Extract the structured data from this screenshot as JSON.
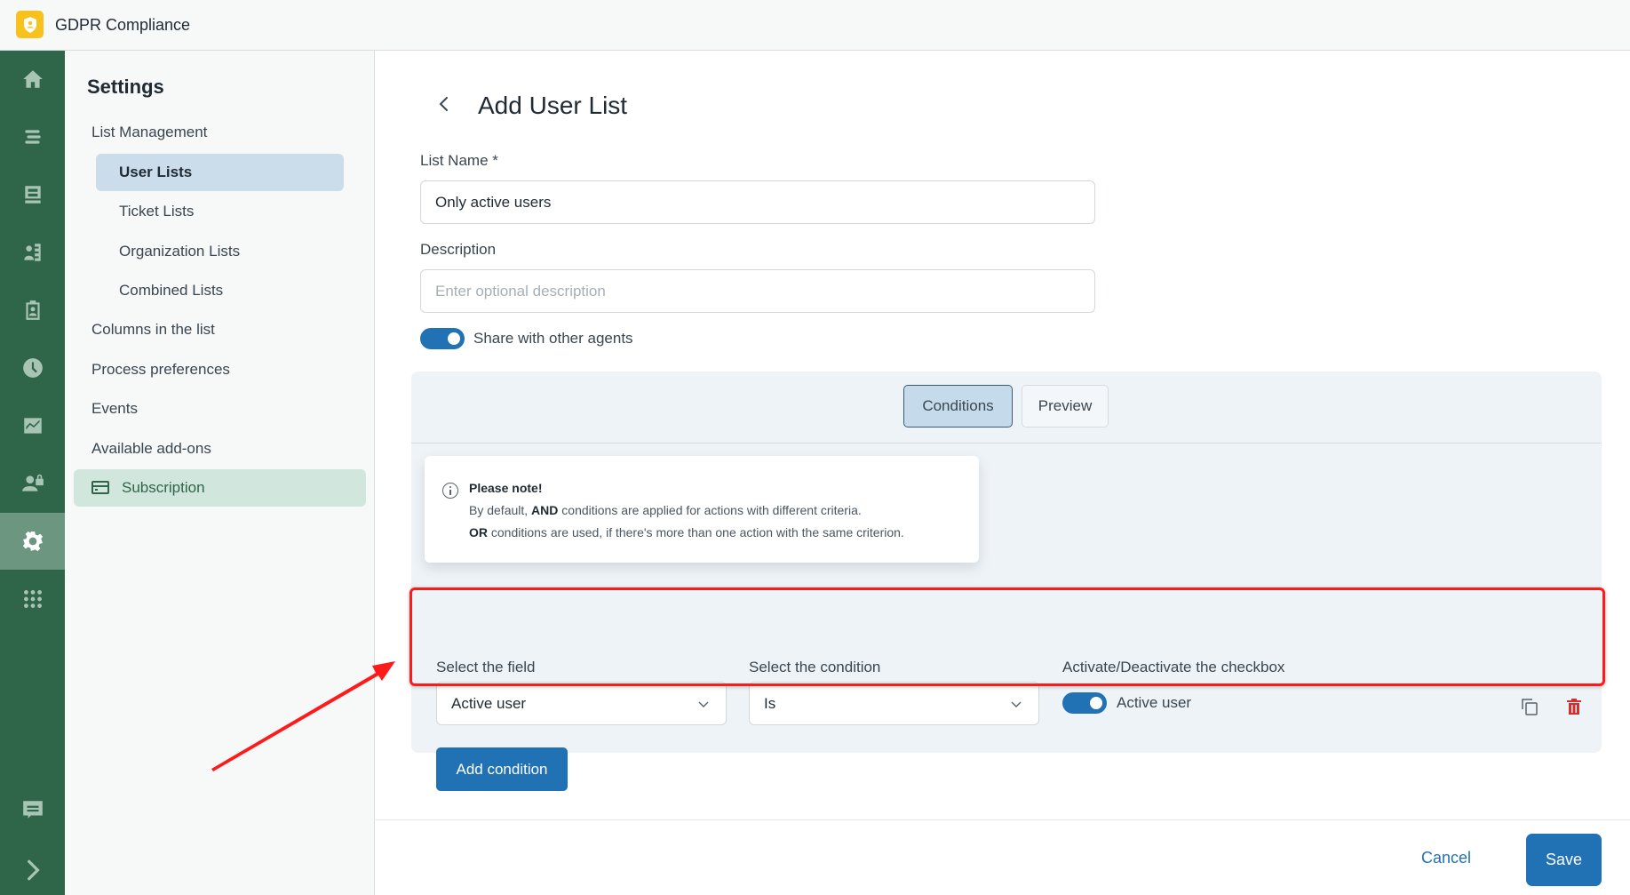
{
  "app": {
    "title": "GDPR Compliance",
    "logo_icon": "shield-user-icon"
  },
  "leftnav": {
    "items": [
      {
        "icon": "home-icon"
      },
      {
        "icon": "list-icon"
      },
      {
        "icon": "inbox-icon"
      },
      {
        "icon": "contacts-book-icon"
      },
      {
        "icon": "badge-icon"
      },
      {
        "icon": "clock-icon"
      },
      {
        "icon": "chart-icon"
      },
      {
        "icon": "user-lock-icon"
      },
      {
        "icon": "gear-icon",
        "active": true
      },
      {
        "icon": "apps-grid-icon"
      },
      {
        "icon": "chat-icon"
      },
      {
        "icon": "chevron-right-icon"
      }
    ]
  },
  "settings": {
    "title": "Settings",
    "menu": [
      {
        "label": "List Management",
        "level": "top"
      },
      {
        "label": "User Lists",
        "level": "sub",
        "selected": true
      },
      {
        "label": "Ticket Lists",
        "level": "sub"
      },
      {
        "label": "Organization Lists",
        "level": "sub"
      },
      {
        "label": "Combined Lists",
        "level": "sub"
      },
      {
        "label": "Columns in the list",
        "level": "top"
      },
      {
        "label": "Process preferences",
        "level": "top"
      },
      {
        "label": "Events",
        "level": "top"
      },
      {
        "label": "Available add-ons",
        "level": "top"
      },
      {
        "label": "Subscription",
        "level": "top",
        "icon": "credit-card-icon"
      }
    ]
  },
  "form": {
    "title": "Add User List",
    "list_name_label": "List Name *",
    "list_name_value": "Only active users",
    "description_label": "Description",
    "description_placeholder": "Enter optional description",
    "share_label": "Share with other agents",
    "share_enabled": true
  },
  "tabs": {
    "conditions": "Conditions",
    "preview": "Preview",
    "active": "Conditions"
  },
  "note": {
    "title": "Please note!",
    "line1_prefix": "By default, ",
    "line1_bold": "AND",
    "line1_suffix": " conditions are applied for actions with different criteria.",
    "line2_bold": "OR",
    "line2_suffix": " conditions are used, if there's more than one action with the same criterion."
  },
  "condition": {
    "field_label": "Select the field",
    "field_value": "Active user",
    "condition_label": "Select the condition",
    "condition_value": "Is",
    "checkbox_label": "Activate/Deactivate the checkbox",
    "checkbox_value_label": "Active user",
    "checkbox_enabled": true
  },
  "buttons": {
    "add_condition": "Add condition",
    "cancel": "Cancel",
    "save": "Save"
  },
  "annotation": {
    "color": "#ff1a1a"
  },
  "colors": {
    "primary": "#2171b5",
    "sidebar": "#2f6549",
    "danger": "#d32f2f",
    "logo": "#f7c21b"
  }
}
